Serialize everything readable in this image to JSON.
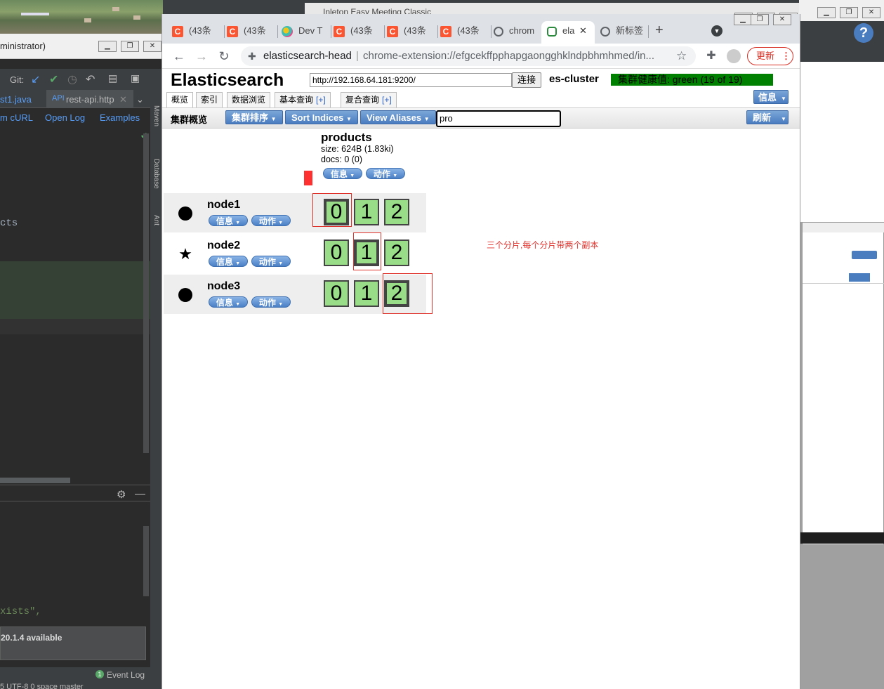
{
  "ide": {
    "title_fragment": "ministrator)",
    "toolbar_git": "Git:",
    "tab_left": "st1.java",
    "tab_right": "rest-api.http",
    "links": [
      "m cURL",
      "Open Log",
      "Examples"
    ],
    "side_tabs": [
      "Maven",
      "Database",
      "Ant"
    ],
    "code_fragment_1": "cts",
    "code_fragment_2": "xists\",",
    "notice": "20.1.4 available",
    "event_log_count": "1",
    "event_log": "Event Log",
    "status_fragment": "5  UTF-8  0 space  master"
  },
  "browser": {
    "tabs": [
      {
        "label": "(43条"
      },
      {
        "label": "(43条"
      },
      {
        "label": "Dev T"
      },
      {
        "label": "(43条"
      },
      {
        "label": "(43条"
      },
      {
        "label": "(43条"
      },
      {
        "label": "chrom"
      },
      {
        "label": "ela"
      },
      {
        "label": "新标签"
      }
    ],
    "new_tab_symbol": "+",
    "close_symbol": "✕",
    "address_site": "elasticsearch-head",
    "address_url": "chrome-extension://efgcekffpphapgaongghklndpbhmhmed/in...",
    "update_label": "更新",
    "back_window_title": "Inleton Easy Meeting Classic"
  },
  "es": {
    "title": "Elasticsearch",
    "url": "http://192.168.64.181:9200/",
    "connect_label": "连接",
    "cluster_name": "es-cluster",
    "health": "集群健康值: green (19 of 19)",
    "info_label": "信息",
    "tabs": [
      {
        "label": "概览"
      },
      {
        "label": "索引"
      },
      {
        "label": "数据浏览"
      },
      {
        "label": "基本查询",
        "plus": "[+]"
      },
      {
        "label": "复合查询",
        "plus": "[+]"
      }
    ],
    "overview_label": "集群概览",
    "sort_cluster": "集群排序",
    "sort_indices": "Sort Indices",
    "view_aliases": "View Aliases",
    "filter_value": "pro",
    "refresh_label": "刷新",
    "index": {
      "name": "products",
      "size": "size: 624B (1.83ki)",
      "docs": "docs: 0 (0)",
      "info": "信息",
      "action": "动作"
    },
    "nodes": [
      {
        "name": "node1",
        "icon": "circle",
        "info": "信息",
        "action": "动作",
        "shards": [
          "0",
          "1",
          "2"
        ],
        "primary_shard": 0
      },
      {
        "name": "node2",
        "icon": "star",
        "info": "信息",
        "action": "动作",
        "shards": [
          "0",
          "1",
          "2"
        ],
        "primary_shard": 1
      },
      {
        "name": "node3",
        "icon": "circle",
        "info": "信息",
        "action": "动作",
        "shards": [
          "0",
          "1",
          "2"
        ],
        "primary_shard": 2
      }
    ],
    "annotation": "三个分片,每个分片带两个副本"
  },
  "colors": {
    "health_green": "#008000",
    "shard_green": "#99dd88",
    "annotation_red": "#e0302a",
    "button_blue": "#4a7cc0"
  }
}
